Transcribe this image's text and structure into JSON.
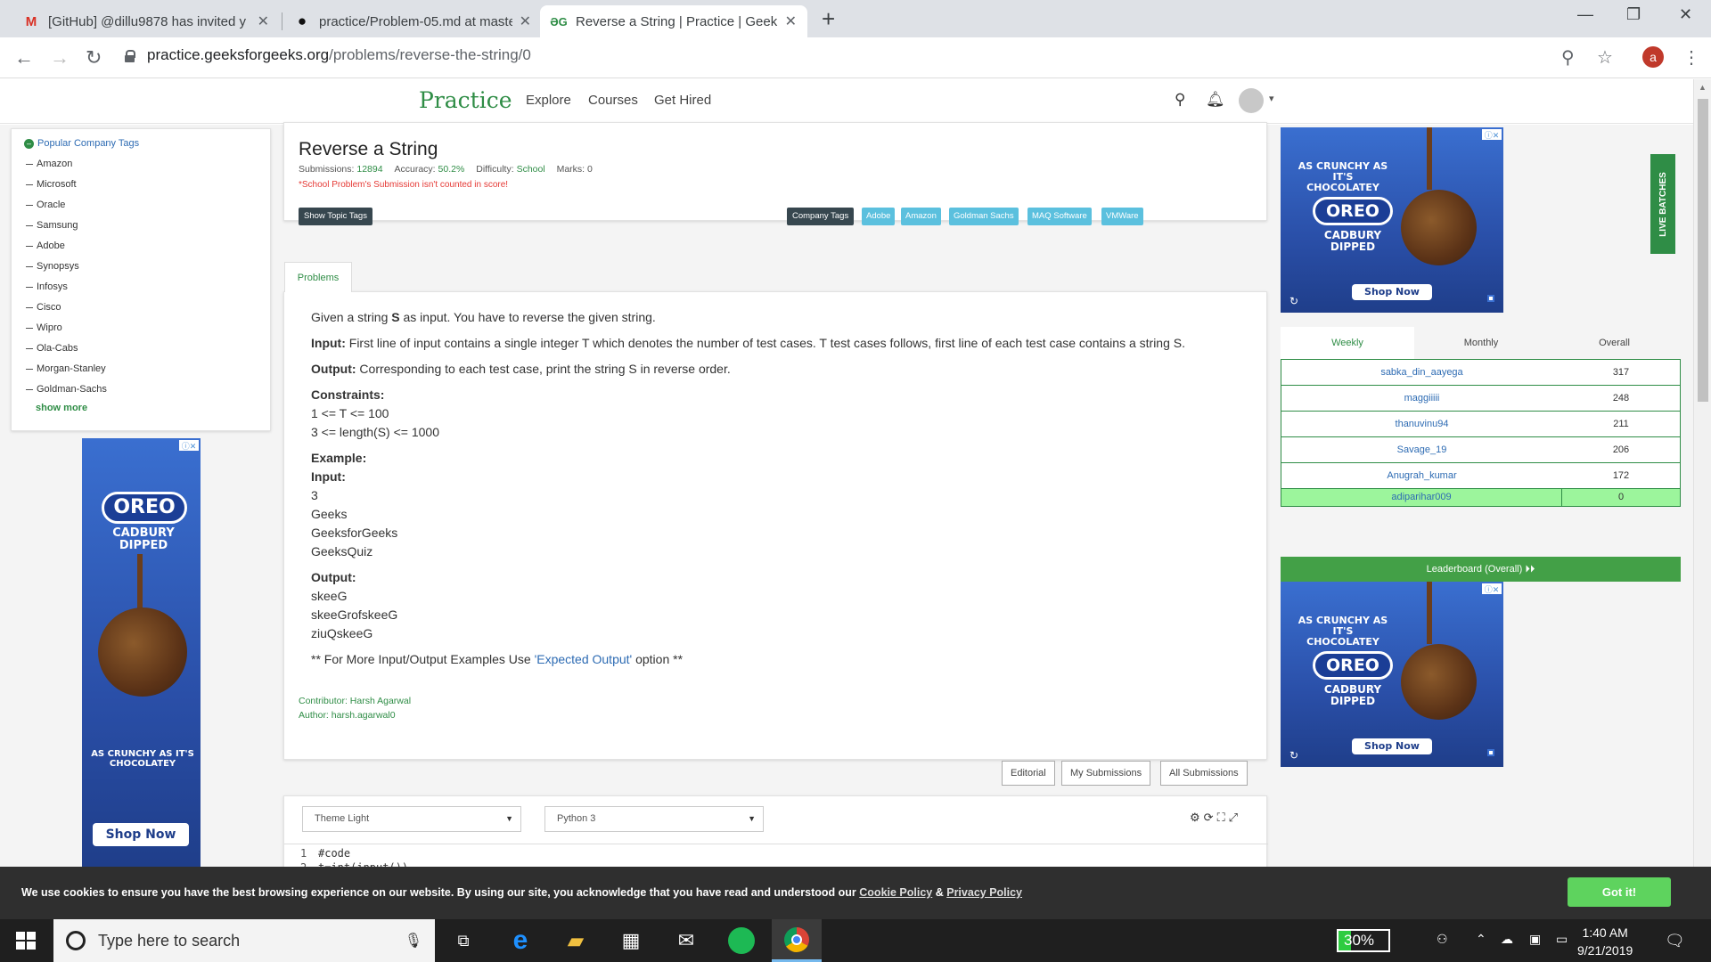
{
  "browser": {
    "tabs": [
      {
        "title": "[GitHub] @dillu9878 has invited y",
        "icon": "gmail-icon"
      },
      {
        "title": "practice/Problem-05.md at maste",
        "icon": "github-icon"
      },
      {
        "title": "Reverse a String | Practice | Geek",
        "icon": "gfg-icon"
      }
    ],
    "url_host": "practice.geeksforgeeks.org",
    "url_path": "/problems/reverse-the-string/0",
    "profile_initial": "a"
  },
  "header": {
    "logo": "Practice",
    "nav": [
      "Explore",
      "Courses",
      "Get Hired"
    ]
  },
  "tags_panel": {
    "title": "Popular Company Tags",
    "items": [
      "Amazon",
      "Microsoft",
      "Oracle",
      "Samsung",
      "Adobe",
      "Synopsys",
      "Infosys",
      "Cisco",
      "Wipro",
      "Ola-Cabs",
      "Morgan-Stanley",
      "Goldman-Sachs"
    ],
    "show_more": "show more"
  },
  "problem": {
    "title": "Reverse a String",
    "submissions_label": "Submissions:",
    "submissions": "12894",
    "accuracy_label": "Accuracy:",
    "accuracy": "50.2%",
    "difficulty_label": "Difficulty:",
    "difficulty": "School",
    "marks_label": "Marks:",
    "marks": "0",
    "note": "*School Problem's Submission isn't counted in score!",
    "show_topic_tags": "Show Topic Tags",
    "company_tags_label": "Company Tags",
    "company_tags": [
      "Adobe",
      "Amazon",
      "Goldman Sachs",
      "MAQ Software",
      "VMWare"
    ],
    "tab_label": "Problems",
    "statement_pre": "Given a string ",
    "statement_s": "S",
    "statement_post": " as input. You have to reverse the given string.",
    "input_label": "Input:",
    "input_text": "First line of input contains a single integer T which denotes the number of test cases. T test cases follows, first line of each test case contains a string S.",
    "output_label": "Output:",
    "output_text": "Corresponding to each test case, print the string S in reverse order.",
    "constraints_label": "Constraints:",
    "constraints": [
      "1 <= T <= 100",
      "3 <= length(S) <= 1000"
    ],
    "example_label": "Example:",
    "example_input_label": "Input:",
    "example_input": [
      "3",
      "Geeks",
      "GeeksforGeeks",
      "GeeksQuiz"
    ],
    "example_output_label": "Output:",
    "example_output": [
      "skeeG",
      "skeeGrofskeeG",
      "ziuQskeeG"
    ],
    "more_pre": "** For More Input/Output Examples Use ",
    "more_link": "'Expected Output'",
    "more_post": " option **",
    "contributor": "Contributor: Harsh Agarwal",
    "author": "Author: harsh.agarwal0",
    "buttons": [
      "Editorial",
      "My Submissions",
      "All Submissions"
    ]
  },
  "leaderboard": {
    "tabs": [
      "Weekly",
      "Monthly",
      "Overall"
    ],
    "rows": [
      {
        "name": "sabka_din_aayega",
        "score": "317"
      },
      {
        "name": "maggiiiii",
        "score": "248"
      },
      {
        "name": "thanuvinu94",
        "score": "211"
      },
      {
        "name": "Savage_19",
        "score": "206"
      },
      {
        "name": "Anugrah_kumar",
        "score": "172"
      },
      {
        "name": "adiparihar009",
        "score": "0"
      }
    ],
    "button": "Leaderboard (Overall) ⏵⏵"
  },
  "live_batches": "LIVE BATCHES",
  "ads": {
    "slogan_top": "AS CRUNCHY AS IT'S CHOCOLATEY",
    "brand": "OREO",
    "sub": "CADBURY DIPPED",
    "shop": "Shop Now"
  },
  "editor": {
    "theme": "Theme Light",
    "language": "Python 3",
    "lines": [
      {
        "n": "1",
        "code": "#code"
      },
      {
        "n": "2",
        "code": "t=int(input())"
      }
    ]
  },
  "cookie": {
    "text": "We use cookies to ensure you have the best browsing experience on our website. By using our site, you acknowledge that you have read and understood our ",
    "cookie_policy": "Cookie Policy",
    "amp": " & ",
    "privacy_policy": "Privacy Policy",
    "button": "Got it!"
  },
  "taskbar": {
    "search_placeholder": "Type here to search",
    "battery": "30%",
    "time": "1:40 AM",
    "date": "9/21/2019"
  }
}
